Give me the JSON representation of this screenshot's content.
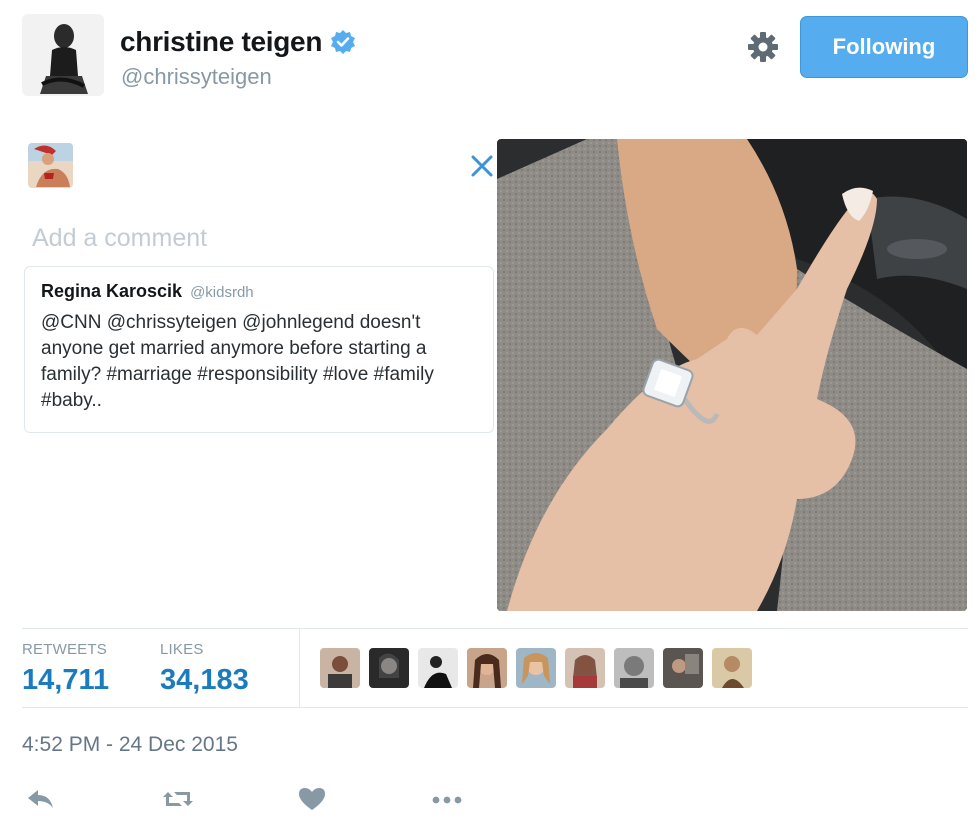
{
  "profile": {
    "display_name": "christine teigen",
    "handle": "@chrissyteigen",
    "follow_button_label": "Following"
  },
  "composer": {
    "placeholder": "Add a comment"
  },
  "quoted_tweet": {
    "name": "Regina Karoscik",
    "handle": "@kidsrdh",
    "text": "@CNN @chrissyteigen @johnlegend doesn't anyone get married anymore before starting a family? #marriage #responsibility #love #family #baby.."
  },
  "stats": {
    "retweets_label": "RETWEETS",
    "retweets_value": "14,711",
    "likes_label": "LIKES",
    "likes_value": "34,183"
  },
  "timestamp": "4:52 PM - 24 Dec 2015",
  "colors": {
    "accent": "#55acee",
    "link_blue": "#1b7bbf",
    "muted": "#8899a6",
    "border": "#e1e8ed"
  },
  "icons": [
    "verified-badge-icon",
    "gear-icon",
    "close-icon",
    "reply-icon",
    "retweet-icon",
    "like-icon",
    "more-icon"
  ]
}
